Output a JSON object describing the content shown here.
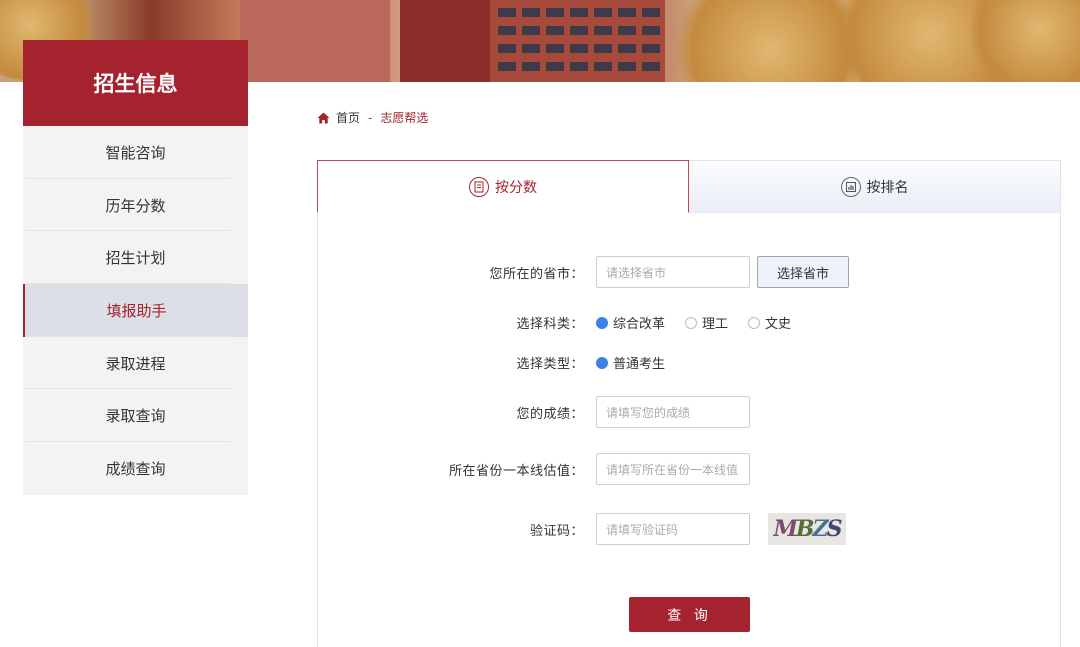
{
  "sidebar": {
    "title": "招生信息",
    "items": [
      {
        "label": "智能咨询"
      },
      {
        "label": "历年分数"
      },
      {
        "label": "招生计划"
      },
      {
        "label": "填报助手"
      },
      {
        "label": "录取进程"
      },
      {
        "label": "录取查询"
      },
      {
        "label": "成绩查询"
      }
    ],
    "active_index": 3
  },
  "breadcrumb": {
    "home": "首页",
    "separator": "-",
    "current": "志愿帮选"
  },
  "tabs": [
    {
      "label": "按分数",
      "icon": "document-icon",
      "active": true
    },
    {
      "label": "按排名",
      "icon": "chart-icon",
      "active": false
    }
  ],
  "form": {
    "province": {
      "label": "您所在的省市：",
      "placeholder": "请选择省市",
      "button": "选择省市"
    },
    "subject": {
      "label": "选择科类：",
      "options": [
        {
          "label": "综合改革",
          "checked": true
        },
        {
          "label": "理工",
          "checked": false
        },
        {
          "label": "文史",
          "checked": false
        }
      ]
    },
    "type": {
      "label": "选择类型：",
      "options": [
        {
          "label": "普通考生",
          "checked": true
        }
      ]
    },
    "score": {
      "label": "您的成绩：",
      "placeholder": "请填写您的成绩"
    },
    "line": {
      "label": "所在省份一本线估值：",
      "placeholder": "请填写所在省份一本线值"
    },
    "captcha": {
      "label": "验证码：",
      "placeholder": "请填写验证码",
      "image_text": "MBZS"
    },
    "submit": "查 询"
  },
  "colors": {
    "primary": "#a4232f",
    "radio_checked": "#3b82e6",
    "sidebar_bg": "#f3f3f3",
    "active_item_bg": "#dcdfe6"
  }
}
